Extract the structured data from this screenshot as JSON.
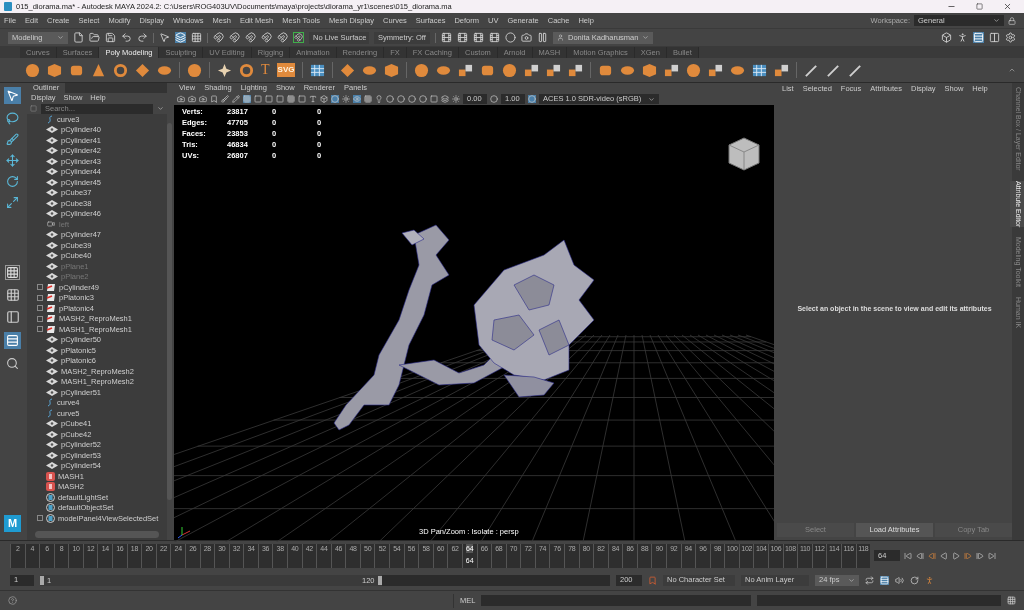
{
  "window": {
    "title": "015_diorama.ma* - Autodesk MAYA 2024.2: C:\\Users\\ROG403UV\\Documents\\maya\\projects\\diorama_yr1\\scenes\\015_diorama.ma"
  },
  "menu_bar": [
    "File",
    "Edit",
    "Create",
    "Select",
    "Modify",
    "Display",
    "Windows",
    "Mesh",
    "Edit Mesh",
    "Mesh Tools",
    "Mesh Display",
    "Curves",
    "Surfaces",
    "Deform",
    "UV",
    "Generate",
    "Cache",
    "Help"
  ],
  "status_line": {
    "mode": "Modeling",
    "live_surface": "No Live Surface",
    "symmetry": "Symmetry: Off",
    "user": "Donita Kadharusman",
    "workspace_label": "Workspace:",
    "workspace": "General"
  },
  "shelf": {
    "tabs": [
      {
        "label": "Curves",
        "selected": false
      },
      {
        "label": "Surfaces",
        "selected": false
      },
      {
        "label": "Poly Modeling",
        "selected": true
      },
      {
        "label": "Sculpting",
        "selected": false
      },
      {
        "label": "UV Editing",
        "selected": false
      },
      {
        "label": "Rigging",
        "selected": false
      },
      {
        "label": "Animation",
        "selected": false
      },
      {
        "label": "Rendering",
        "selected": false
      },
      {
        "label": "FX",
        "selected": false
      },
      {
        "label": "FX Caching",
        "selected": false
      },
      {
        "label": "Custom",
        "selected": false
      },
      {
        "label": "Arnold",
        "selected": false
      },
      {
        "label": "MASH",
        "selected": false
      },
      {
        "label": "Motion Graphics",
        "selected": false
      },
      {
        "label": "XGen",
        "selected": false
      },
      {
        "label": "Bullet",
        "selected": false
      }
    ],
    "text_tool": "T",
    "svg_tool": "SVG"
  },
  "toolbox": {
    "logo": "M"
  },
  "outliner": {
    "title": "Outliner",
    "menu": [
      "Display",
      "Show",
      "Help"
    ],
    "search_placeholder": "Search...",
    "items": [
      {
        "name": "curve3",
        "kind": "curve",
        "hidden": false,
        "collapsible": false
      },
      {
        "name": "pCylinder40",
        "kind": "mesh",
        "hidden": false,
        "collapsible": false
      },
      {
        "name": "pCylinder41",
        "kind": "mesh",
        "hidden": false,
        "collapsible": false
      },
      {
        "name": "pCylinder42",
        "kind": "mesh",
        "hidden": false,
        "collapsible": false
      },
      {
        "name": "pCylinder43",
        "kind": "mesh",
        "hidden": false,
        "collapsible": false
      },
      {
        "name": "pCylinder44",
        "kind": "mesh",
        "hidden": false,
        "collapsible": false
      },
      {
        "name": "pCylinder45",
        "kind": "mesh",
        "hidden": false,
        "collapsible": false
      },
      {
        "name": "pCube37",
        "kind": "mesh",
        "hidden": false,
        "collapsible": false
      },
      {
        "name": "pCube38",
        "kind": "mesh",
        "hidden": false,
        "collapsible": false
      },
      {
        "name": "pCylinder46",
        "kind": "mesh",
        "hidden": false,
        "collapsible": false
      },
      {
        "name": "left",
        "kind": "camera",
        "hidden": true,
        "collapsible": false
      },
      {
        "name": "pCylinder47",
        "kind": "mesh",
        "hidden": false,
        "collapsible": false
      },
      {
        "name": "pCube39",
        "kind": "mesh",
        "hidden": false,
        "collapsible": false
      },
      {
        "name": "pCube40",
        "kind": "mesh",
        "hidden": false,
        "collapsible": false
      },
      {
        "name": "pPlane1",
        "kind": "mesh",
        "hidden": true,
        "collapsible": false
      },
      {
        "name": "pPlane2",
        "kind": "mesh",
        "hidden": true,
        "collapsible": false
      },
      {
        "name": "pCylinder49",
        "kind": "mash_mesh",
        "hidden": false,
        "collapsible": true
      },
      {
        "name": "pPlatonic3",
        "kind": "mash_mesh",
        "hidden": false,
        "collapsible": true
      },
      {
        "name": "pPlatonic4",
        "kind": "mash_mesh",
        "hidden": false,
        "collapsible": true
      },
      {
        "name": "MASH2_ReproMesh1",
        "kind": "mash_mesh",
        "hidden": false,
        "collapsible": true
      },
      {
        "name": "MASH1_ReproMesh1",
        "kind": "mash_mesh",
        "hidden": false,
        "collapsible": true
      },
      {
        "name": "pCylinder50",
        "kind": "mesh",
        "hidden": false,
        "collapsible": false
      },
      {
        "name": "pPlatonic5",
        "kind": "mesh",
        "hidden": false,
        "collapsible": false
      },
      {
        "name": "pPlatonic6",
        "kind": "mesh",
        "hidden": false,
        "collapsible": false
      },
      {
        "name": "MASH2_ReproMesh2",
        "kind": "mesh",
        "hidden": false,
        "collapsible": false
      },
      {
        "name": "MASH1_ReproMesh2",
        "kind": "mesh",
        "hidden": false,
        "collapsible": false
      },
      {
        "name": "pCylinder51",
        "kind": "mesh",
        "hidden": false,
        "collapsible": false
      },
      {
        "name": "curve4",
        "kind": "curve",
        "hidden": false,
        "collapsible": false
      },
      {
        "name": "curve5",
        "kind": "curve",
        "hidden": false,
        "collapsible": false
      },
      {
        "name": "pCube41",
        "kind": "mesh",
        "hidden": false,
        "collapsible": false
      },
      {
        "name": "pCube42",
        "kind": "mesh",
        "hidden": false,
        "collapsible": false
      },
      {
        "name": "pCylinder52",
        "kind": "mesh",
        "hidden": false,
        "collapsible": false
      },
      {
        "name": "pCylinder53",
        "kind": "mesh",
        "hidden": false,
        "collapsible": false
      },
      {
        "name": "pCylinder54",
        "kind": "mesh",
        "hidden": false,
        "collapsible": false
      },
      {
        "name": "MASH1",
        "kind": "mash",
        "hidden": false,
        "collapsible": false
      },
      {
        "name": "MASH2",
        "kind": "mash",
        "hidden": false,
        "collapsible": false
      },
      {
        "name": "defaultLightSet",
        "kind": "set",
        "hidden": false,
        "collapsible": false
      },
      {
        "name": "defaultObjectSet",
        "kind": "set",
        "hidden": false,
        "collapsible": false
      },
      {
        "name": "modelPanel4ViewSelectedSet",
        "kind": "set",
        "hidden": false,
        "collapsible": true
      }
    ]
  },
  "viewport": {
    "menu": [
      "View",
      "Shading",
      "Lighting",
      "Show",
      "Renderer",
      "Panels"
    ],
    "exposure": "0.00",
    "gamma": "1.00",
    "color_space": "ACES 1.0 SDR-video (sRGB)",
    "stats": [
      {
        "label": "Verts:",
        "values": [
          "23817",
          "0",
          "0"
        ]
      },
      {
        "label": "Edges:",
        "values": [
          "47705",
          "0",
          "0"
        ]
      },
      {
        "label": "Faces:",
        "values": [
          "23853",
          "0",
          "0"
        ]
      },
      {
        "label": "Tris:",
        "values": [
          "46834",
          "0",
          "0"
        ]
      },
      {
        "label": "UVs:",
        "values": [
          "26807",
          "0",
          "0"
        ]
      }
    ],
    "status": "3D Pan/Zoom : Isolate : persp"
  },
  "attribute_editor": {
    "menu": [
      "List",
      "Selected",
      "Focus",
      "Attributes",
      "Display",
      "Show",
      "Help"
    ],
    "message": "Select an object in the scene to view and edit its attributes",
    "buttons": [
      "Select",
      "Load Attributes",
      "Copy Tab"
    ],
    "side_tabs": [
      {
        "label": "Channel Box / Layer Editor",
        "selected": false
      },
      {
        "label": "Attribute Editor",
        "selected": true
      },
      {
        "label": "Modeling Toolkit",
        "selected": false
      },
      {
        "label": "Human IK",
        "selected": false
      }
    ]
  },
  "timeline": {
    "ticks": [
      {
        "label": "2",
        "selected": false
      },
      {
        "label": "4",
        "selected": false
      },
      {
        "label": "6",
        "selected": false
      },
      {
        "label": "8",
        "selected": false
      },
      {
        "label": "10",
        "selected": false
      },
      {
        "label": "12",
        "selected": false
      },
      {
        "label": "14",
        "selected": false
      },
      {
        "label": "16",
        "selected": false
      },
      {
        "label": "18",
        "selected": false
      },
      {
        "label": "20",
        "selected": false
      },
      {
        "label": "22",
        "selected": false
      },
      {
        "label": "24",
        "selected": false
      },
      {
        "label": "26",
        "selected": false
      },
      {
        "label": "28",
        "selected": false
      },
      {
        "label": "30",
        "selected": false
      },
      {
        "label": "32",
        "selected": false
      },
      {
        "label": "34",
        "selected": false
      },
      {
        "label": "36",
        "selected": false
      },
      {
        "label": "38",
        "selected": false
      },
      {
        "label": "40",
        "selected": false
      },
      {
        "label": "42",
        "selected": false
      },
      {
        "label": "44",
        "selected": false
      },
      {
        "label": "46",
        "selected": false
      },
      {
        "label": "48",
        "selected": false
      },
      {
        "label": "50",
        "selected": false
      },
      {
        "label": "52",
        "selected": false
      },
      {
        "label": "54",
        "selected": false
      },
      {
        "label": "56",
        "selected": false
      },
      {
        "label": "58",
        "selected": false
      },
      {
        "label": "60",
        "selected": false
      },
      {
        "label": "62",
        "selected": false
      },
      {
        "label": "64",
        "selected": true
      },
      {
        "label": "66",
        "selected": false
      },
      {
        "label": "68",
        "selected": false
      },
      {
        "label": "70",
        "selected": false
      },
      {
        "label": "72",
        "selected": false
      },
      {
        "label": "74",
        "selected": false
      },
      {
        "label": "76",
        "selected": false
      },
      {
        "label": "78",
        "selected": false
      },
      {
        "label": "80",
        "selected": false
      },
      {
        "label": "82",
        "selected": false
      },
      {
        "label": "84",
        "selected": false
      },
      {
        "label": "86",
        "selected": false
      },
      {
        "label": "88",
        "selected": false
      },
      {
        "label": "90",
        "selected": false
      },
      {
        "label": "92",
        "selected": false
      },
      {
        "label": "94",
        "selected": false
      },
      {
        "label": "96",
        "selected": false
      },
      {
        "label": "98",
        "selected": false
      },
      {
        "label": "100",
        "selected": false
      },
      {
        "label": "102",
        "selected": false
      },
      {
        "label": "104",
        "selected": false
      },
      {
        "label": "106",
        "selected": false
      },
      {
        "label": "108",
        "selected": false
      },
      {
        "label": "110",
        "selected": false
      },
      {
        "label": "112",
        "selected": false
      },
      {
        "label": "114",
        "selected": false
      },
      {
        "label": "116",
        "selected": false
      },
      {
        "label": "118",
        "selected": false
      }
    ],
    "playhead_label": "64",
    "current_frame": "64"
  },
  "range": {
    "level": 0.6,
    "start": "1",
    "range_start": "1",
    "range_end": "120",
    "end": "200",
    "character_set": "No Character Set",
    "anim_layer": "No Anim Layer",
    "fps": "24 fps"
  },
  "command_line": {
    "language": "MEL"
  }
}
